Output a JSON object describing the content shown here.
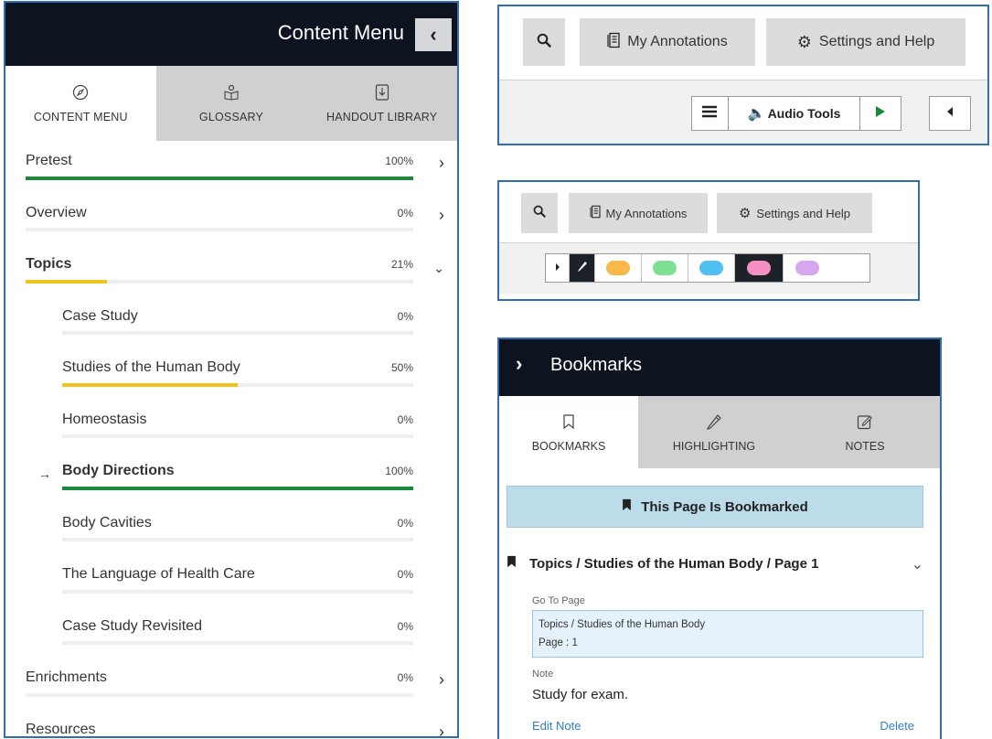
{
  "content_menu": {
    "title": "Content Menu",
    "close_icon": "chevron-left-icon",
    "tabs": [
      {
        "label": "CONTENT MENU",
        "icon": "compass-icon",
        "active": true
      },
      {
        "label": "GLOSSARY",
        "icon": "book-person-icon",
        "active": false
      },
      {
        "label": "HANDOUT LIBRARY",
        "icon": "download-doc-icon",
        "active": false
      }
    ],
    "items": [
      {
        "label": "Pretest",
        "pct": "100%",
        "progress": 1.0,
        "color": "#1a8a3a",
        "chevron": "right"
      },
      {
        "label": "Overview",
        "pct": "0%",
        "progress": 0,
        "color": "#1a8a3a",
        "chevron": "right"
      },
      {
        "label": "Topics",
        "pct": "21%",
        "progress": 0.21,
        "color": "#f2c21d",
        "chevron": "down"
      },
      {
        "label": "Case Study",
        "pct": "0%",
        "progress": 0,
        "color": "#f2c21d"
      },
      {
        "label": "Studies of the Human Body",
        "pct": "50%",
        "progress": 0.5,
        "color": "#f2c21d"
      },
      {
        "label": "Homeostasis",
        "pct": "0%",
        "progress": 0,
        "color": "#f2c21d"
      },
      {
        "label": "Body Directions",
        "pct": "100%",
        "progress": 1.0,
        "color": "#1a8a3a"
      },
      {
        "label": "Body Cavities",
        "pct": "0%",
        "progress": 0,
        "color": "#f2c21d"
      },
      {
        "label": "The Language of Health Care",
        "pct": "0%",
        "progress": 0,
        "color": "#f2c21d"
      },
      {
        "label": "Case Study Revisited",
        "pct": "0%",
        "progress": 0,
        "color": "#f2c21d"
      },
      {
        "label": "Enrichments",
        "pct": "0%",
        "progress": 0,
        "color": "#1a8a3a",
        "chevron": "right"
      },
      {
        "label": "Resources",
        "pct": "",
        "progress": 0,
        "color": "#1a8a3a",
        "chevron": "right"
      }
    ]
  },
  "toolbar": {
    "search_icon": "search-icon",
    "annotations_label": "My Annotations",
    "settings_label": "Settings and Help",
    "audio_tools_label": "Audio Tools"
  },
  "highlight_colors": [
    "#f6b94a",
    "#7fe08f",
    "#4fc0ef",
    "#f58fc4",
    "#d6a6ef"
  ],
  "bookmarks": {
    "title": "Bookmarks",
    "tabs": [
      {
        "label": "BOOKMARKS",
        "icon": "bookmark-icon"
      },
      {
        "label": "HIGHLIGHTING",
        "icon": "highlighter-icon"
      },
      {
        "label": "NOTES",
        "icon": "edit-note-icon"
      }
    ],
    "banner": "This Page Is Bookmarked",
    "entry_title": "Topics / Studies of the Human Body / Page 1",
    "goto_label": "Go To Page",
    "goto_line1": "Topics / Studies of the Human Body",
    "goto_line2": "Page : 1",
    "note_label": "Note",
    "note_text": "Study for exam.",
    "edit_label": "Edit Note",
    "delete_label": "Delete"
  }
}
